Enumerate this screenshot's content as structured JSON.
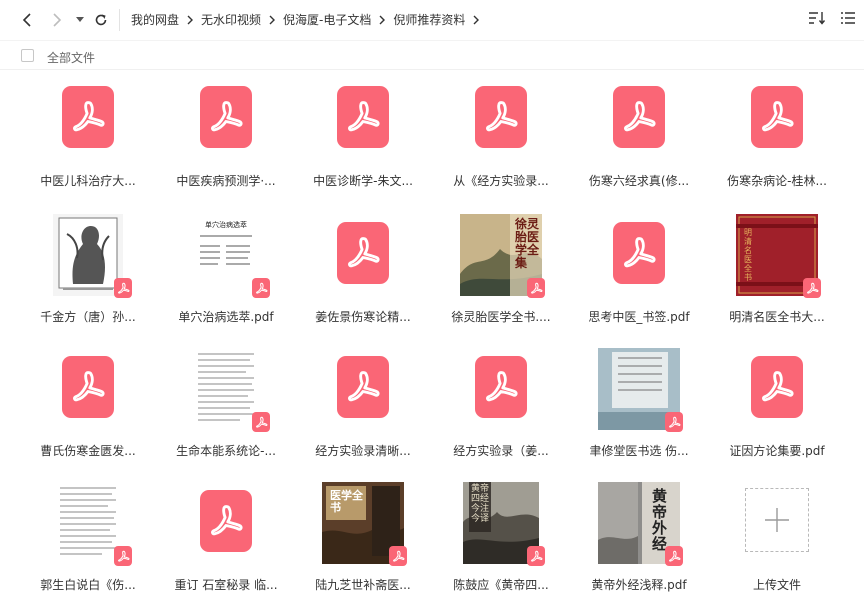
{
  "breadcrumb": [
    "我的网盘",
    "无水印视频",
    "倪海厦-电子文档",
    "倪师推荐资料"
  ],
  "subbar": {
    "all_files_label": "全部文件"
  },
  "colors": {
    "pdf": "#fa6676",
    "text": "#333333",
    "muted": "#666666"
  },
  "files": [
    {
      "name": "中医儿科治疗大...",
      "kind": "pdf-icon"
    },
    {
      "name": "中医疾病预测学·...",
      "kind": "pdf-icon"
    },
    {
      "name": "中医诊断学-朱文...",
      "kind": "pdf-icon"
    },
    {
      "name": "从《经方实验录...",
      "kind": "pdf-icon"
    },
    {
      "name": "伤寒六经求真(修...",
      "kind": "pdf-icon"
    },
    {
      "name": "伤寒杂病论-桂林...",
      "kind": "pdf-icon"
    },
    {
      "name": "千金方（唐）孙...",
      "kind": "cover-engraving"
    },
    {
      "name": "单穴治病选萃.pdf",
      "kind": "cover-doc-text",
      "cover_title": "单穴治病选萃"
    },
    {
      "name": "姜佐景伤寒论精...",
      "kind": "pdf-icon"
    },
    {
      "name": "徐灵胎医学全书....",
      "kind": "cover-landscape",
      "cover_title": "徐灵胎医学全集"
    },
    {
      "name": "思考中医_书签.pdf",
      "kind": "pdf-icon"
    },
    {
      "name": "明清名医全书大...",
      "kind": "cover-red",
      "cover_title": "明清名医全书"
    },
    {
      "name": "曹氏伤寒金匮发...",
      "kind": "pdf-icon"
    },
    {
      "name": "生命本能系统论-...",
      "kind": "cover-doc-lines"
    },
    {
      "name": "经方实验录清晰...",
      "kind": "pdf-icon"
    },
    {
      "name": "经方实验录（姜...",
      "kind": "pdf-icon"
    },
    {
      "name": "聿修堂医书选  伤...",
      "kind": "cover-blue"
    },
    {
      "name": "证因方论集要.pdf",
      "kind": "pdf-icon"
    },
    {
      "name": "郭生白说白《伤...",
      "kind": "cover-doc-lines"
    },
    {
      "name": "重订 石室秘录 临...",
      "kind": "pdf-icon"
    },
    {
      "name": "陆九芝世补斋医...",
      "kind": "cover-brown",
      "cover_title": "医学全书"
    },
    {
      "name": "陈鼓应《黄帝四...",
      "kind": "cover-landscape2",
      "cover_title": "黄帝四经今注今译"
    },
    {
      "name": "黄帝外经浅释.pdf",
      "kind": "cover-gray",
      "cover_title": "黄帝外经"
    },
    {
      "name": "上传文件",
      "kind": "upload"
    }
  ]
}
